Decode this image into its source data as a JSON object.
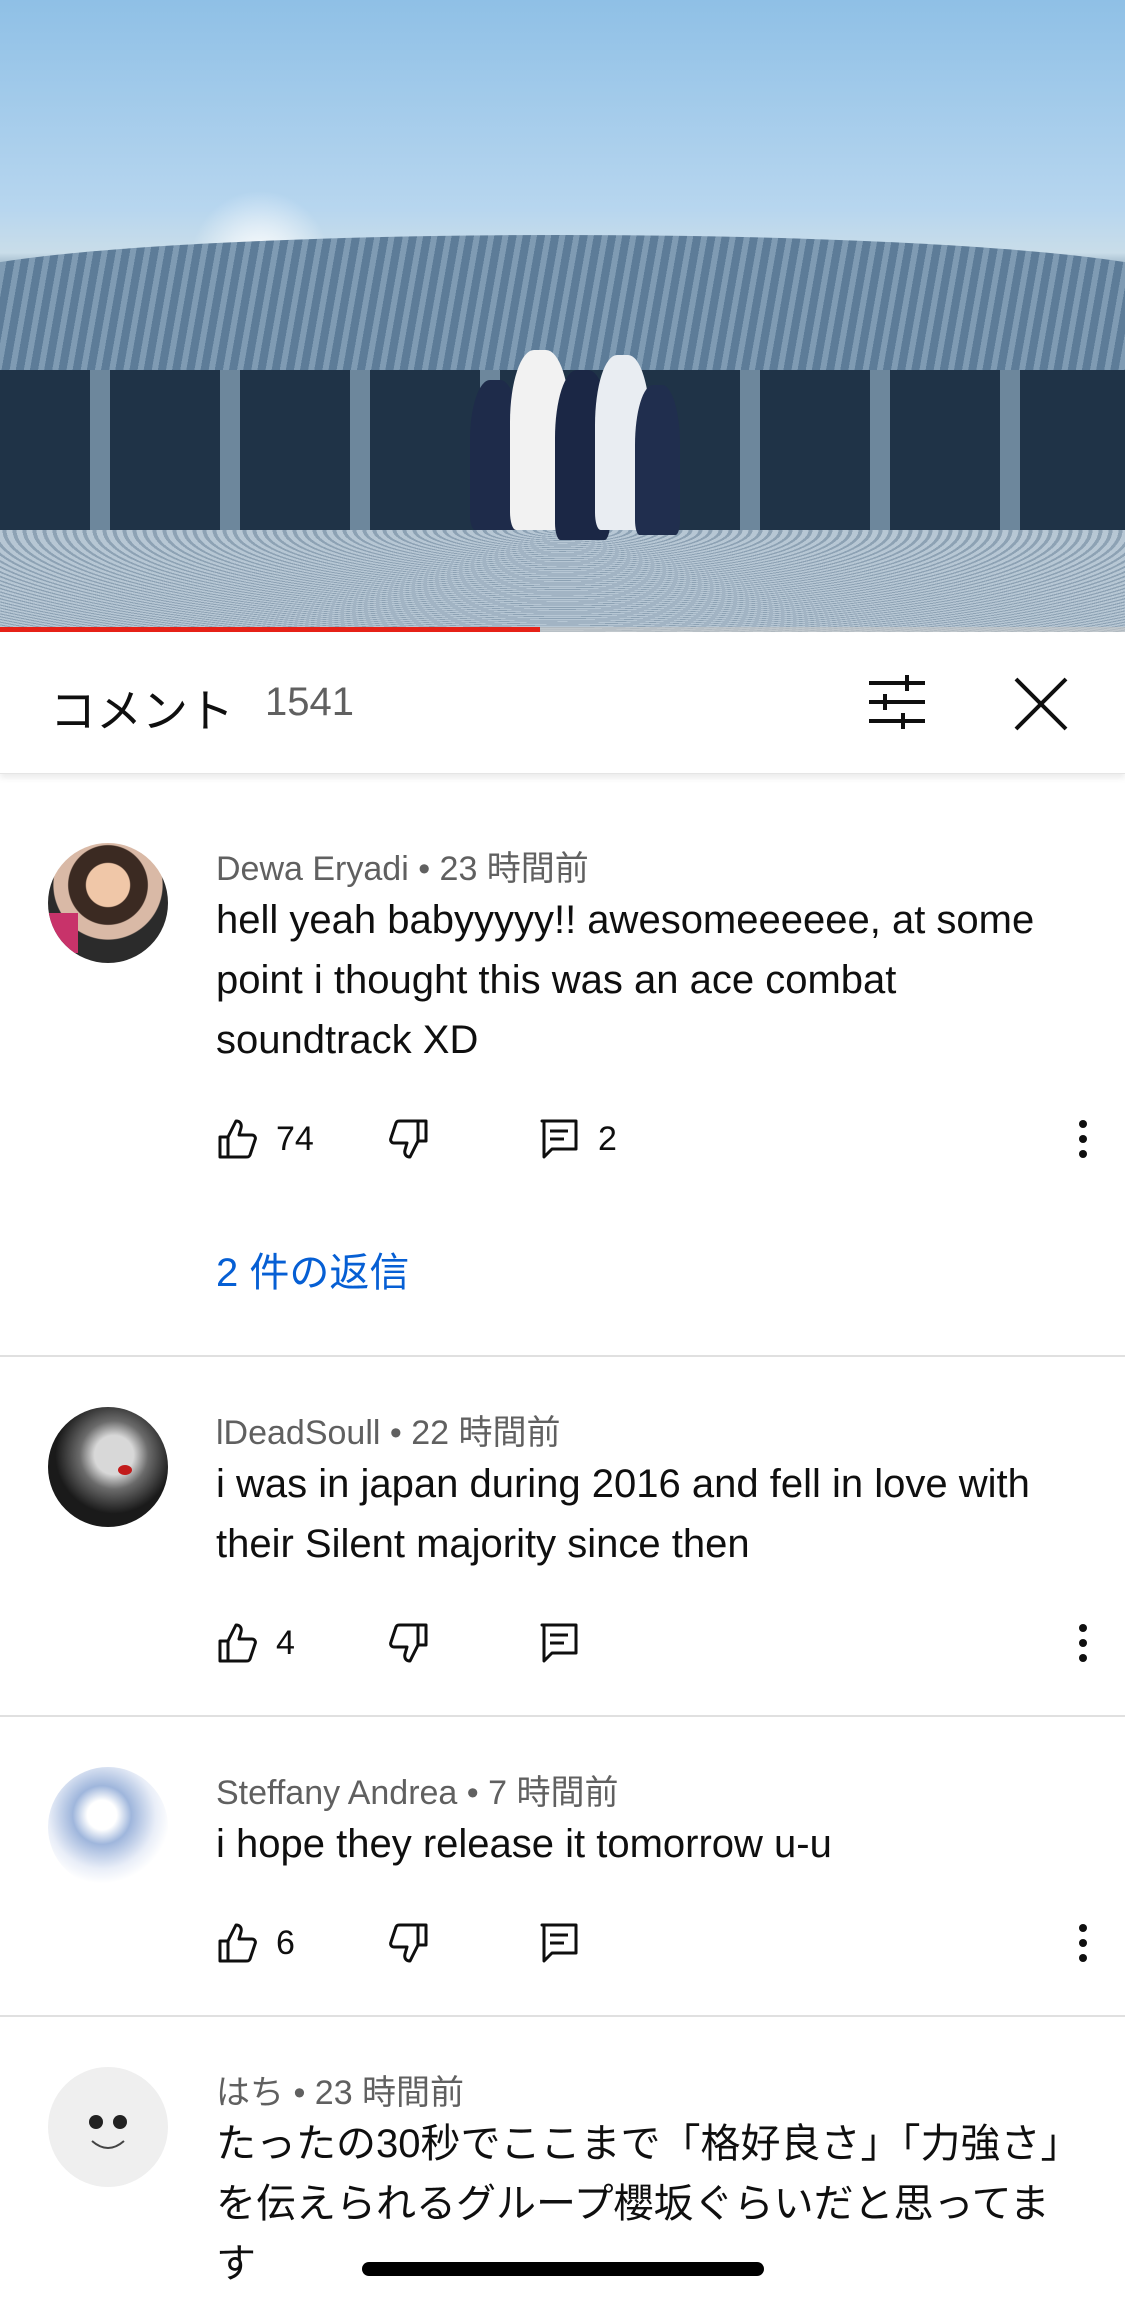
{
  "video": {
    "progress_percent": 48
  },
  "header": {
    "title": "コメント",
    "count": "1541"
  },
  "comments": [
    {
      "author": "Dewa Eryadi",
      "time": "23 時間前",
      "text": "hell yeah babyyyyy!! awesomeeeeee, at some point i thought this was an ace combat soundtrack XD",
      "likes": "74",
      "replies": "2",
      "replies_link": "2 件の返信"
    },
    {
      "author": "lDeadSoull",
      "time": "22 時間前",
      "text": "i was in japan during 2016 and fell in love with their Silent majority since then",
      "likes": "4"
    },
    {
      "author": "Steffany Andrea",
      "time": "7 時間前",
      "text": "i hope they release it tomorrow u-u",
      "likes": "6"
    },
    {
      "author": "はち",
      "time": "23 時間前",
      "text": "たったの30秒でここまで「格好良さ」「力強さ」を伝えられるグループ櫻坂ぐらいだと思ってます"
    }
  ],
  "separator": " • ",
  "icons": {
    "like": "thumbs-up-icon",
    "dislike": "thumbs-down-icon",
    "reply": "reply-comment-icon",
    "more": "more-vertical-icon",
    "filter": "filter-sliders-icon",
    "close": "close-icon"
  },
  "colors": {
    "accent_link": "#065fd4",
    "progress": "#e62117"
  }
}
